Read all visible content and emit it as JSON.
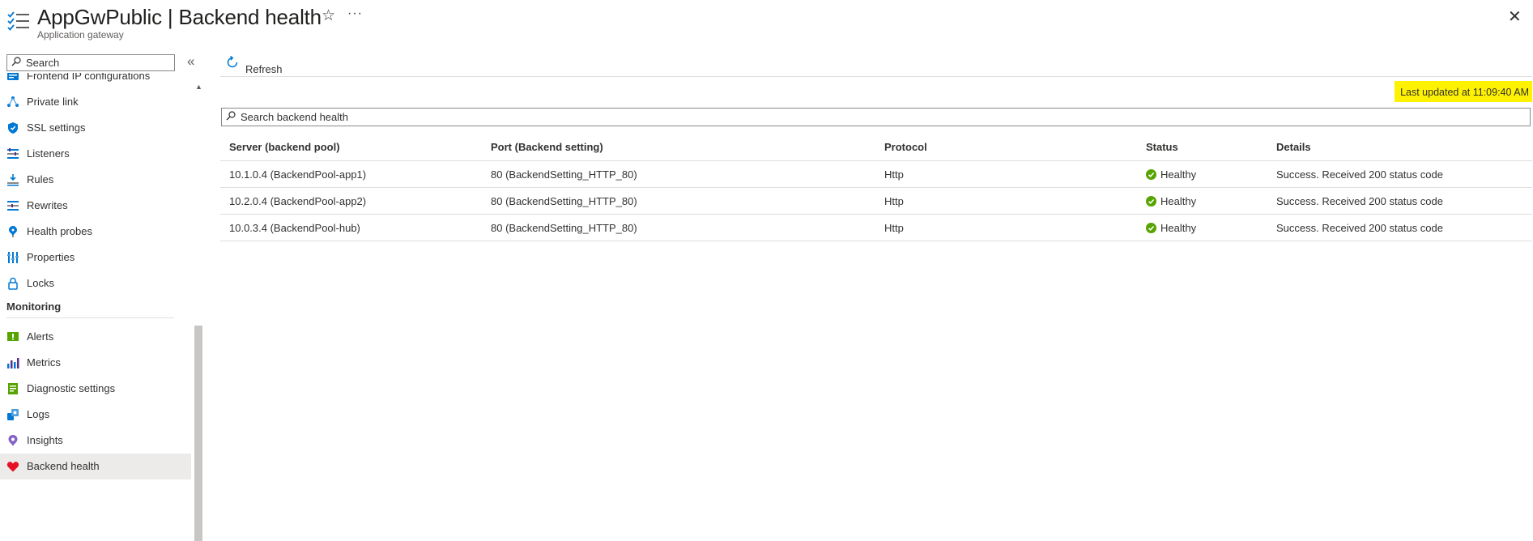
{
  "header": {
    "title": "AppGwPublic | Backend health",
    "subtitle": "Application gateway",
    "more_label": "···"
  },
  "sidebar": {
    "search_placeholder": "Search",
    "items": [
      {
        "label": "Frontend IP configurations",
        "icon": "frontend-ip-icon"
      },
      {
        "label": "Private link",
        "icon": "private-link-icon"
      },
      {
        "label": "SSL settings",
        "icon": "ssl-shield-icon"
      },
      {
        "label": "Listeners",
        "icon": "listeners-icon"
      },
      {
        "label": "Rules",
        "icon": "rules-icon"
      },
      {
        "label": "Rewrites",
        "icon": "rewrites-icon"
      },
      {
        "label": "Health probes",
        "icon": "health-probe-icon"
      },
      {
        "label": "Properties",
        "icon": "properties-icon"
      },
      {
        "label": "Locks",
        "icon": "lock-icon"
      }
    ],
    "monitoring_section": "Monitoring",
    "monitoring_items": [
      {
        "label": "Alerts",
        "icon": "alerts-icon"
      },
      {
        "label": "Metrics",
        "icon": "metrics-icon"
      },
      {
        "label": "Diagnostic settings",
        "icon": "diagnostic-settings-icon"
      },
      {
        "label": "Logs",
        "icon": "logs-icon"
      },
      {
        "label": "Insights",
        "icon": "insights-icon"
      },
      {
        "label": "Backend health",
        "icon": "heart-icon",
        "active": true
      }
    ]
  },
  "toolbar": {
    "refresh_label": "Refresh"
  },
  "last_updated": "Last updated at 11:09:40 AM",
  "search": {
    "placeholder": "Search backend health"
  },
  "table": {
    "columns": [
      "Server (backend pool)",
      "Port (Backend setting)",
      "Protocol",
      "Status",
      "Details"
    ],
    "rows": [
      {
        "server": "10.1.0.4 (BackendPool-app1)",
        "port": "80 (BackendSetting_HTTP_80)",
        "protocol": "Http",
        "status": "Healthy",
        "details": "Success. Received 200 status code"
      },
      {
        "server": "10.2.0.4 (BackendPool-app2)",
        "port": "80 (BackendSetting_HTTP_80)",
        "protocol": "Http",
        "status": "Healthy",
        "details": "Success. Received 200 status code"
      },
      {
        "server": "10.0.3.4 (BackendPool-hub)",
        "port": "80 (BackendSetting_HTTP_80)",
        "protocol": "Http",
        "status": "Healthy",
        "details": "Success. Received 200 status code"
      }
    ]
  },
  "colors": {
    "highlight": "#fff200",
    "healthy": "#57a300",
    "accent": "#0078d4",
    "heart": "#e81123"
  }
}
